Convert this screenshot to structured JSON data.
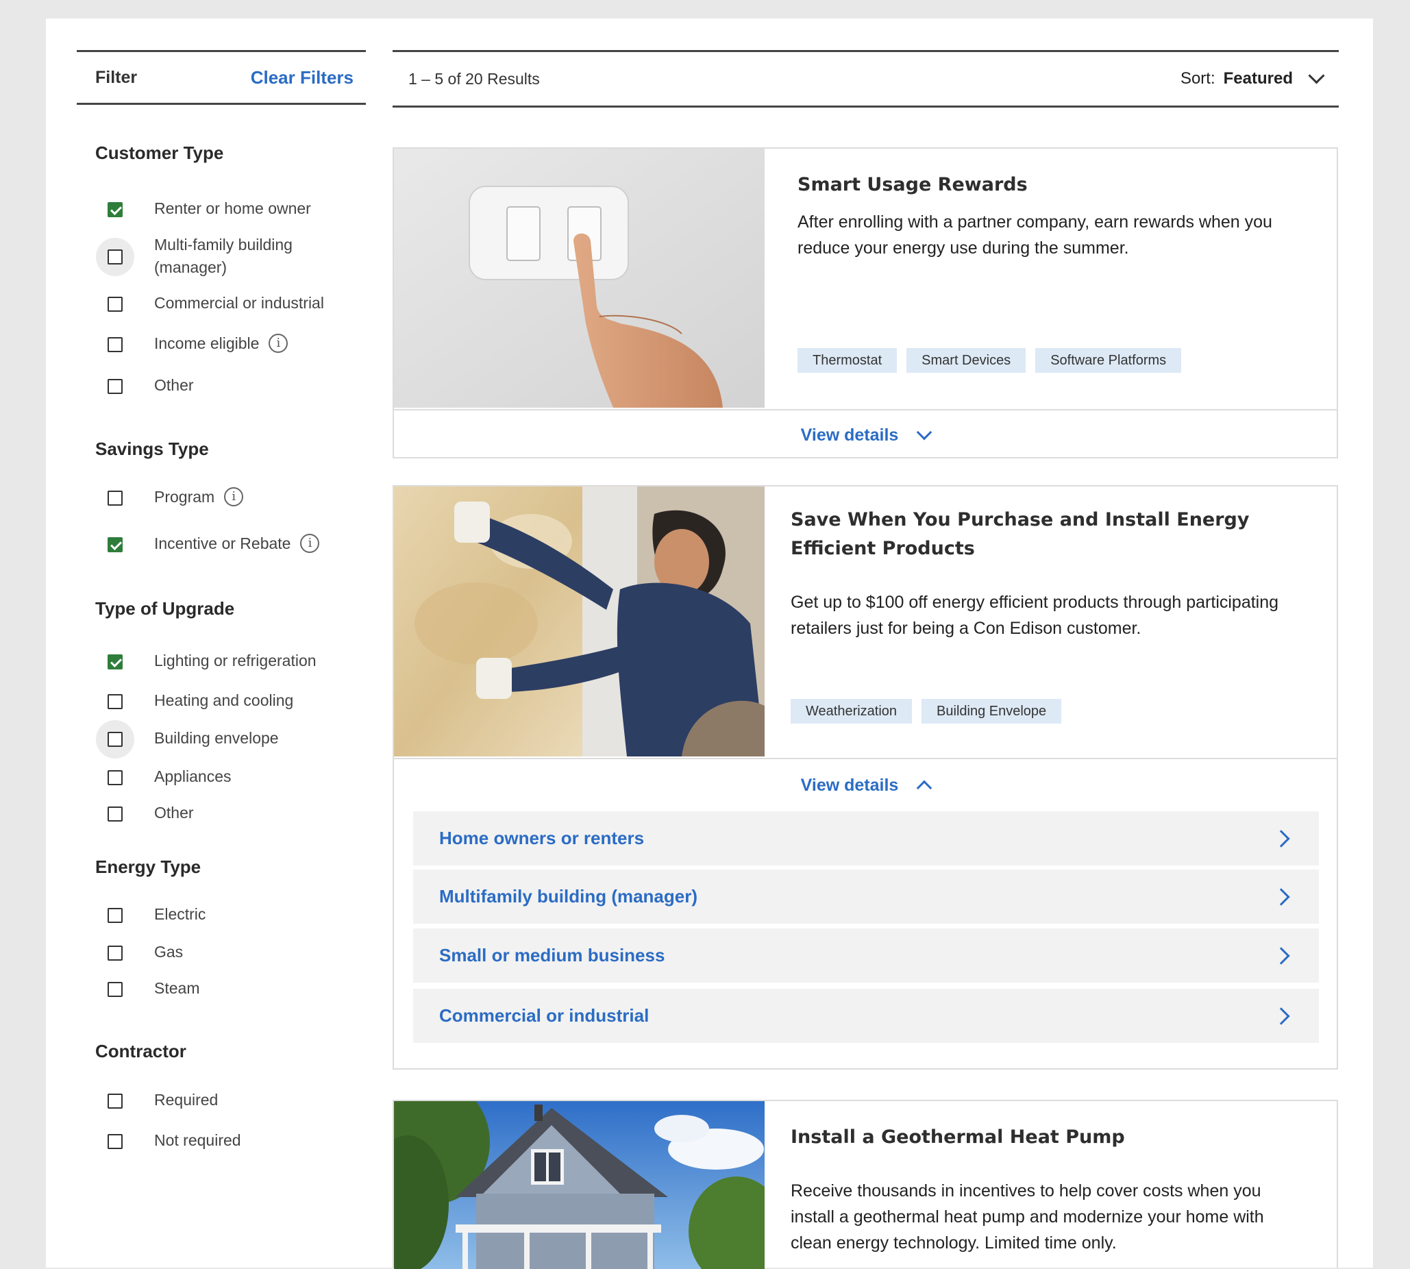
{
  "sidebar": {
    "filter_title": "Filter",
    "clear_label": "Clear Filters",
    "sections": [
      {
        "title": "Customer Type",
        "options": [
          {
            "label": "Renter or home owner",
            "checked": true
          },
          {
            "label": "Multi-family building (manager)",
            "checked": false
          },
          {
            "label": "Commercial or industrial",
            "checked": false
          },
          {
            "label": "Income eligible",
            "checked": false,
            "info": true
          },
          {
            "label": "Other",
            "checked": false
          }
        ]
      },
      {
        "title": "Savings Type",
        "options": [
          {
            "label": "Program",
            "checked": false,
            "info": true
          },
          {
            "label": "Incentive or Rebate",
            "checked": true,
            "info": true
          }
        ]
      },
      {
        "title": "Type of Upgrade",
        "options": [
          {
            "label": "Lighting or refrigeration",
            "checked": true
          },
          {
            "label": "Heating and cooling",
            "checked": false
          },
          {
            "label": "Building envelope",
            "checked": false
          },
          {
            "label": "Appliances",
            "checked": false
          },
          {
            "label": "Other",
            "checked": false
          }
        ]
      },
      {
        "title": "Energy Type",
        "options": [
          {
            "label": "Electric",
            "checked": false
          },
          {
            "label": "Gas",
            "checked": false
          },
          {
            "label": "Steam",
            "checked": false
          }
        ]
      },
      {
        "title": "Contractor",
        "options": [
          {
            "label": "Required",
            "checked": false
          },
          {
            "label": "Not required",
            "checked": false
          }
        ]
      }
    ],
    "info_glyph": "i"
  },
  "results": {
    "count_text": "1 – 5 of 20 Results",
    "sort_label": "Sort:",
    "sort_value": "Featured"
  },
  "cards": [
    {
      "title": "Smart Usage Rewards",
      "description": "After enrolling with a partner company, earn rewards when you reduce your energy use during the summer.",
      "tags": [
        "Thermostat",
        "Smart Devices",
        "Software Platforms"
      ],
      "details_label": "View details",
      "image": "light-switch-photo"
    },
    {
      "title": "Save When You Purchase and Install Energy Efficient Products",
      "description": "Get up to $100 off energy efficient products through participating retailers just for being a Con Edison customer.",
      "tags": [
        "Weatherization",
        "Building Envelope"
      ],
      "details_label": "View details",
      "image": "insulation-worker-photo",
      "accordion": [
        "Home owners or renters",
        "Multifamily building (manager)",
        "Small or medium business",
        "Commercial or industrial"
      ]
    },
    {
      "title": "Install a Geothermal Heat Pump",
      "description": "Receive thousands in incentives to help cover costs when you install a geothermal heat pump and modernize your home with clean energy technology. Limited time only.",
      "image": "house-photo"
    }
  ],
  "colors": {
    "accent": "#2b6cc4",
    "check": "#2f7d3a",
    "tag_bg": "#dde9f5"
  }
}
